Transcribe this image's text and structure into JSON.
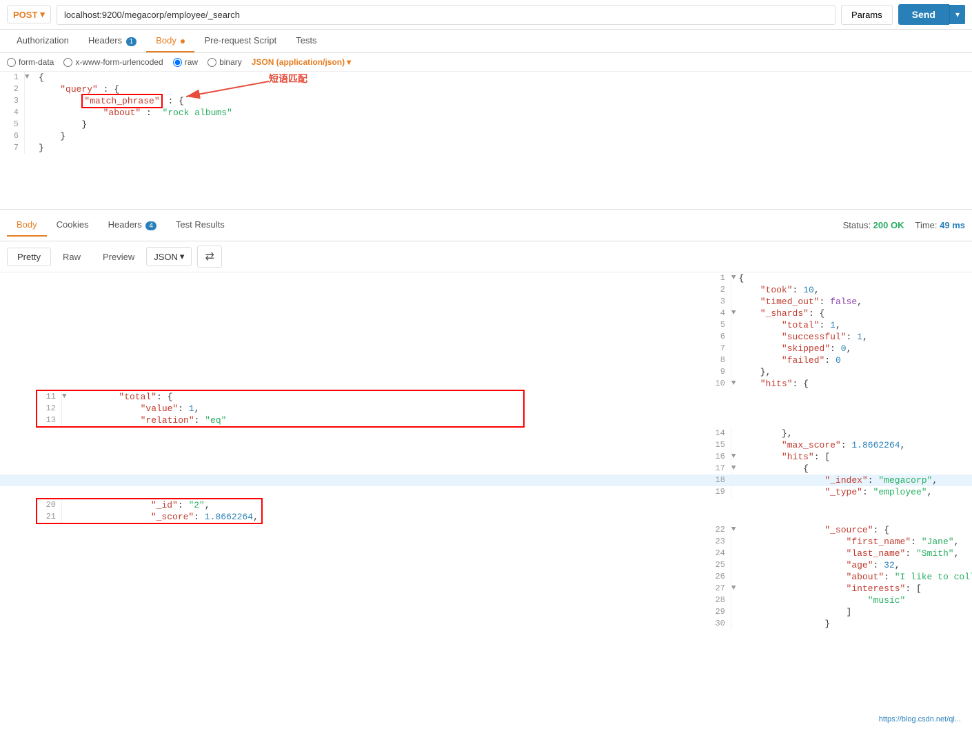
{
  "topbar": {
    "method": "POST",
    "url": "localhost:9200/megacorp/employee/_search",
    "params_label": "Params",
    "send_label": "Send"
  },
  "req_tabs": [
    {
      "label": "Authorization",
      "active": false,
      "badge": null,
      "dot": false
    },
    {
      "label": "Headers",
      "active": false,
      "badge": "1",
      "dot": false
    },
    {
      "label": "Body",
      "active": true,
      "badge": null,
      "dot": true
    },
    {
      "label": "Pre-request Script",
      "active": false,
      "badge": null,
      "dot": false
    },
    {
      "label": "Tests",
      "active": false,
      "badge": null,
      "dot": false
    }
  ],
  "body_options": [
    {
      "label": "form-data",
      "value": "form-data",
      "checked": false
    },
    {
      "label": "x-www-form-urlencoded",
      "value": "x-www-form-urlencoded",
      "checked": false
    },
    {
      "label": "raw",
      "value": "raw",
      "checked": true
    },
    {
      "label": "binary",
      "value": "binary",
      "checked": false
    }
  ],
  "json_format": "JSON (application/json)",
  "annotation_text": "短语匹配",
  "request_code": [
    {
      "num": 1,
      "toggle": "▼",
      "content": "{",
      "highlight": false
    },
    {
      "num": 2,
      "toggle": "",
      "content": "    \"query\" : {",
      "highlight": false
    },
    {
      "num": 3,
      "toggle": "",
      "content": "        \"match_phrase\" : {",
      "highlight": true,
      "boxed": true
    },
    {
      "num": 4,
      "toggle": "",
      "content": "            \"about\" :  \"rock albums\"",
      "highlight": false
    },
    {
      "num": 5,
      "toggle": "",
      "content": "        }",
      "highlight": false
    },
    {
      "num": 6,
      "toggle": "",
      "content": "    }",
      "highlight": false
    },
    {
      "num": 7,
      "toggle": "",
      "content": "}",
      "highlight": false
    }
  ],
  "resp_tabs": [
    {
      "label": "Body",
      "active": true
    },
    {
      "label": "Cookies",
      "active": false
    },
    {
      "label": "Headers",
      "active": false,
      "badge": "4"
    },
    {
      "label": "Test Results",
      "active": false
    }
  ],
  "status_label": "Status:",
  "status_value": "200 OK",
  "time_label": "Time:",
  "time_value": "49 ms",
  "view_tabs": [
    {
      "label": "Pretty",
      "active": true
    },
    {
      "label": "Raw",
      "active": false
    },
    {
      "label": "Preview",
      "active": false
    }
  ],
  "json_view_label": "JSON",
  "response_lines": [
    {
      "num": 1,
      "toggle": "▼",
      "content": "{",
      "highlight": false,
      "boxed": false
    },
    {
      "num": 2,
      "toggle": "",
      "content": "    \"took\": 10,",
      "highlight": false,
      "boxed": false
    },
    {
      "num": 3,
      "toggle": "",
      "content": "    \"timed_out\": false,",
      "highlight": false,
      "boxed": false
    },
    {
      "num": 4,
      "toggle": "▼",
      "content": "    \"_shards\": {",
      "highlight": false,
      "boxed": false
    },
    {
      "num": 5,
      "toggle": "",
      "content": "        \"total\": 1,",
      "highlight": false,
      "boxed": false
    },
    {
      "num": 6,
      "toggle": "",
      "content": "        \"successful\": 1,",
      "highlight": false,
      "boxed": false
    },
    {
      "num": 7,
      "toggle": "",
      "content": "        \"skipped\": 0,",
      "highlight": false,
      "boxed": false
    },
    {
      "num": 8,
      "toggle": "",
      "content": "        \"failed\": 0",
      "highlight": false,
      "boxed": false
    },
    {
      "num": 9,
      "toggle": "",
      "content": "    },",
      "highlight": false,
      "boxed": false
    },
    {
      "num": 10,
      "toggle": "▼",
      "content": "    \"hits\": {",
      "highlight": false,
      "boxed": false
    },
    {
      "num": 11,
      "toggle": "▼",
      "content": "        \"total\": {",
      "highlight": false,
      "boxed": true
    },
    {
      "num": 12,
      "toggle": "",
      "content": "            \"value\": 1,",
      "highlight": false,
      "boxed": true
    },
    {
      "num": 13,
      "toggle": "",
      "content": "            \"relation\": \"eq\"",
      "highlight": false,
      "boxed": true
    },
    {
      "num": 14,
      "toggle": "",
      "content": "        },",
      "highlight": false,
      "boxed": false
    },
    {
      "num": 15,
      "toggle": "",
      "content": "        \"max_score\": 1.8662264,",
      "highlight": false,
      "boxed": false
    },
    {
      "num": 16,
      "toggle": "▼",
      "content": "        \"hits\": [",
      "highlight": false,
      "boxed": false
    },
    {
      "num": 17,
      "toggle": "▼",
      "content": "            {",
      "highlight": false,
      "boxed": false
    },
    {
      "num": 18,
      "toggle": "",
      "content": "                \"_index\": \"megacorp\",",
      "highlight": true,
      "boxed": false
    },
    {
      "num": 19,
      "toggle": "",
      "content": "                \"_type\": \"employee\",",
      "highlight": false,
      "boxed": false
    },
    {
      "num": 20,
      "toggle": "",
      "content": "                \"_id\": \"2\",",
      "highlight": false,
      "boxed": true
    },
    {
      "num": 21,
      "toggle": "",
      "content": "                \"_score\": 1.8662264,",
      "highlight": false,
      "boxed": true
    },
    {
      "num": 22,
      "toggle": "▼",
      "content": "                \"_source\": {",
      "highlight": false,
      "boxed": false
    },
    {
      "num": 23,
      "toggle": "",
      "content": "                    \"first_name\": \"Jane\",",
      "highlight": false,
      "boxed": false
    },
    {
      "num": 24,
      "toggle": "",
      "content": "                    \"last_name\": \"Smith\",",
      "highlight": false,
      "boxed": false
    },
    {
      "num": 25,
      "toggle": "",
      "content": "                    \"age\": 32,",
      "highlight": false,
      "boxed": false
    },
    {
      "num": 26,
      "toggle": "",
      "content": "                    \"about\": \"I like to collect rock albums\",",
      "highlight": false,
      "boxed": true
    },
    {
      "num": 27,
      "toggle": "▼",
      "content": "                    \"interests\": [",
      "highlight": false,
      "boxed": false
    },
    {
      "num": 28,
      "toggle": "",
      "content": "                        \"music\"",
      "highlight": false,
      "boxed": false
    },
    {
      "num": 29,
      "toggle": "",
      "content": "                    ]",
      "highlight": false,
      "boxed": false
    },
    {
      "num": 30,
      "toggle": "",
      "content": "                }",
      "highlight": false,
      "boxed": false
    }
  ],
  "watermark": "https://blog.csdn.net/ql..."
}
